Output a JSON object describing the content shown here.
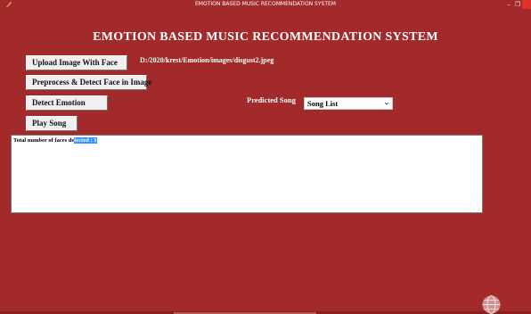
{
  "window": {
    "title": "EMOTION BASED MUSIC RECOMMENDATION SYSTEM",
    "minimize_glyph": "–",
    "maximize_glyph": "❐",
    "close_glyph": "",
    "app_icon": "feather-icon"
  },
  "header": {
    "title": "EMOTION BASED MUSIC RECOMMENDATION SYSTEM"
  },
  "buttons": {
    "upload": "Upload Image With Face",
    "preprocess": "Preprocess & Detect Face in Image",
    "detect": "Detect Emotion",
    "play": "Play Song"
  },
  "image_path": "D:/2020/krest/Emotion/images/disgust2.jpeg",
  "prediction": {
    "label": "Predicted Song",
    "select_value": "Song List"
  },
  "output": {
    "prefix": "Total number of faces de",
    "selected": "tected : 1"
  },
  "icons": {
    "dropdown": "chevron-down-icon",
    "corner": "globe-icon"
  },
  "colors": {
    "background": "#a32a2a",
    "close_button": "#e0322c",
    "selection": "#3399ff"
  }
}
